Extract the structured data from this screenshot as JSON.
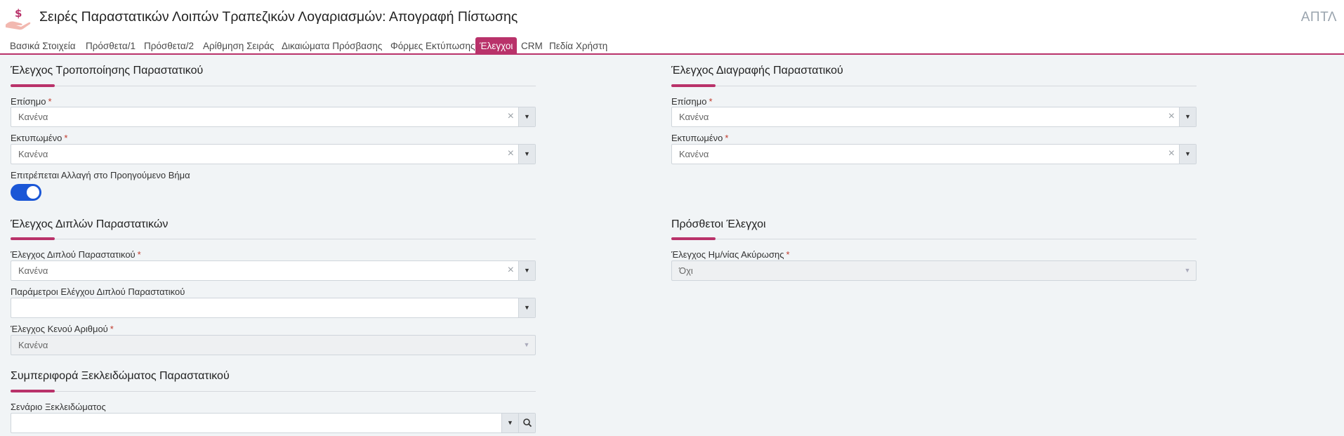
{
  "header": {
    "title": "Σειρές Παραστατικών Λοιπών Τραπεζικών Λογαριασμών: Απογραφή Πίστωσης",
    "right_text": "ΑΠΤΛ",
    "icon": "hand-dollar-icon",
    "accent_color": "#b9326a"
  },
  "tabs": [
    {
      "label": "Βασικά Στοιχεία"
    },
    {
      "label": "Πρόσθετα/1"
    },
    {
      "label": "Πρόσθετα/2"
    },
    {
      "label": "Αρίθμηση Σειράς"
    },
    {
      "label": "Δικαιώματα Πρόσβασης"
    },
    {
      "label": "Φόρμες Εκτύπωσης"
    },
    {
      "label": "Έλεγχοι",
      "active": true
    },
    {
      "label": "CRM"
    },
    {
      "label": "Πεδία Χρήστη"
    }
  ],
  "modify_check": {
    "title": "Έλεγχος Τροποποίησης Παραστατικού",
    "official": {
      "label": "Επίσημο",
      "required": "*",
      "value": "Κανένα"
    },
    "printed": {
      "label": "Εκτυπωμένο",
      "required": "*",
      "value": "Κανένα"
    },
    "allow_prev_step": {
      "label": "Επιτρέπεται Αλλαγή στο Προηγούμενο Βήμα",
      "enabled": true
    }
  },
  "delete_check": {
    "title": "Έλεγχος Διαγραφής Παραστατικού",
    "official": {
      "label": "Επίσημο",
      "required": "*",
      "value": "Κανένα"
    },
    "printed": {
      "label": "Εκτυπωμένο",
      "required": "*",
      "value": "Κανένα"
    }
  },
  "duplicate_check": {
    "title": "Έλεγχος Διπλών Παραστατικών",
    "duplicate": {
      "label": "Έλεγχος Διπλού Παραστατικού",
      "required": "*",
      "value": "Κανένα"
    },
    "params": {
      "label": "Παράμετροι Ελέγχου Διπλού Παραστατικού",
      "value": ""
    },
    "blank_number": {
      "label": "Έλεγχος Κενού Αριθμού",
      "required": "*",
      "value": "Κανένα"
    }
  },
  "extra_checks": {
    "title": "Πρόσθετοι Έλεγχοι",
    "cancel_date": {
      "label": "Έλεγχος Ημ/νίας Ακύρωσης",
      "required": "*",
      "value": "Όχι"
    }
  },
  "unlock": {
    "title": "Συμπεριφορά Ξεκλειδώματος Παραστατικού",
    "scenario": {
      "label": "Σενάριο Ξεκλειδώματος",
      "value": ""
    }
  },
  "glyphs": {
    "clear": "×",
    "arrow": "▼"
  }
}
